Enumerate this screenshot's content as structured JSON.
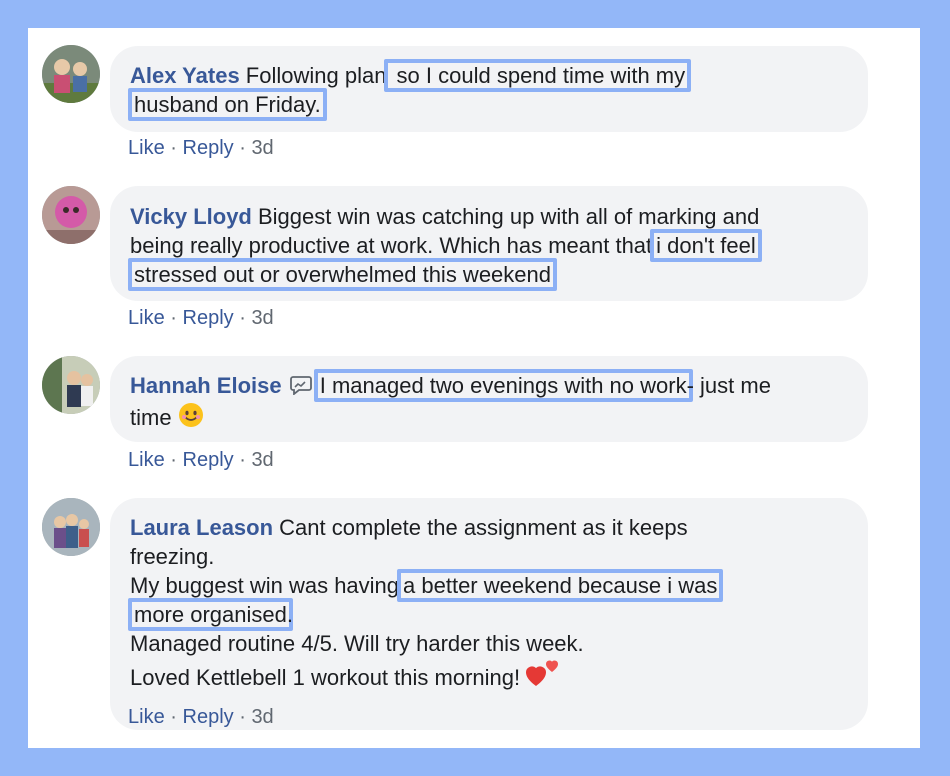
{
  "comments": [
    {
      "author": "Alex Yates",
      "line1_plain": " Following plan",
      "line1_hl": " so I could spend time with my",
      "line2_hl": "husband on Friday.",
      "like": "Like",
      "reply": "Reply",
      "time": "3d"
    },
    {
      "author": "Vicky Lloyd",
      "line1": " Biggest win was catching up with all of marking and",
      "line2_plain": "being really productive at work. Which has meant that",
      "line2_hl": "i don't feel",
      "line3_hl": "stressed out or overwhelmed this weekend",
      "like": "Like",
      "reply": "Reply",
      "time": "3d"
    },
    {
      "author": "Hannah Eloise",
      "line1_hl": "I managed two evenings with no work",
      "line1_plain": "- just me",
      "line2": "time",
      "like": "Like",
      "reply": "Reply",
      "time": "3d"
    },
    {
      "author": "Laura Leason",
      "line1": " Cant complete the assignment as it keeps",
      "line2": "freezing.",
      "line3_plain": "My buggest win was having",
      "line3_hl": "a better weekend because i was",
      "line4_hl": "more organised",
      "line4_plain": ".",
      "line5": "Managed routine 4/5. Will try harder this week.",
      "line6": "Loved Kettlebell 1 workout this morning!",
      "like": "Like",
      "reply": "Reply",
      "time": "3d"
    }
  ],
  "separator": "·",
  "colors": {
    "page_bg": "#93b7f8",
    "author": "#385898",
    "highlight": "#8cb0f5",
    "bubble": "#f2f3f5"
  }
}
